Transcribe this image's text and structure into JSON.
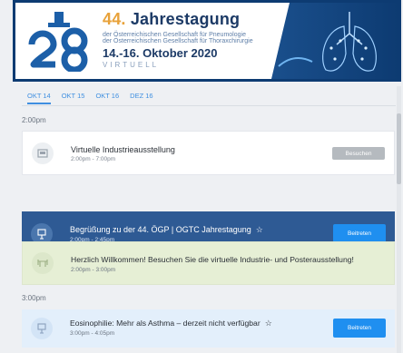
{
  "banner": {
    "heading_number": "44.",
    "heading_text": "Jahrestagung",
    "line1": "der Österreichischen Gesellschaft für Pneumologie",
    "line2": "der Österreichischen Gesellschaft für Thoraxchirurgie",
    "dates": "14.-16. Oktober 2020",
    "subtitle": "VIRTUELL"
  },
  "tabs": [
    {
      "label": "OKT 14",
      "active": true
    },
    {
      "label": "OKT 15",
      "active": false
    },
    {
      "label": "OKT 16",
      "active": false
    },
    {
      "label": "DEZ 16",
      "active": false
    }
  ],
  "time_labels": [
    "2:00pm",
    "3:00pm"
  ],
  "sessions": [
    {
      "title": "Virtuelle Industrieausstellung",
      "time": "2:00pm - 7:00pm",
      "button": "Besuchen",
      "icon": "exhibition-icon"
    },
    {
      "title": "Begrüßung zu der 44. ÖGP | OGTC Jahrestagung",
      "time": "2:00pm - 2:45pm",
      "button": "Beitreten",
      "icon": "presentation-icon"
    },
    {
      "title": "Herzlich Willkommen! Besuchen Sie die virtuelle Industrie- und Posterausstellung!",
      "time": "2:00pm - 3:00pm",
      "icon": "table-icon"
    },
    {
      "title": "Eosinophilie: Mehr als Asthma – derzeit nicht verfügbar",
      "time": "3:00pm - 4:05pm",
      "button": "Beitreten",
      "icon": "presentation-icon"
    }
  ],
  "colors": {
    "accent": "#3f8fe0",
    "banner_frame": "#0d3b72",
    "featured_card": "#2e5a94",
    "join_button": "#1f8ff0",
    "highlight_card": "#e6efd5",
    "upcoming_card": "#e3effb"
  }
}
